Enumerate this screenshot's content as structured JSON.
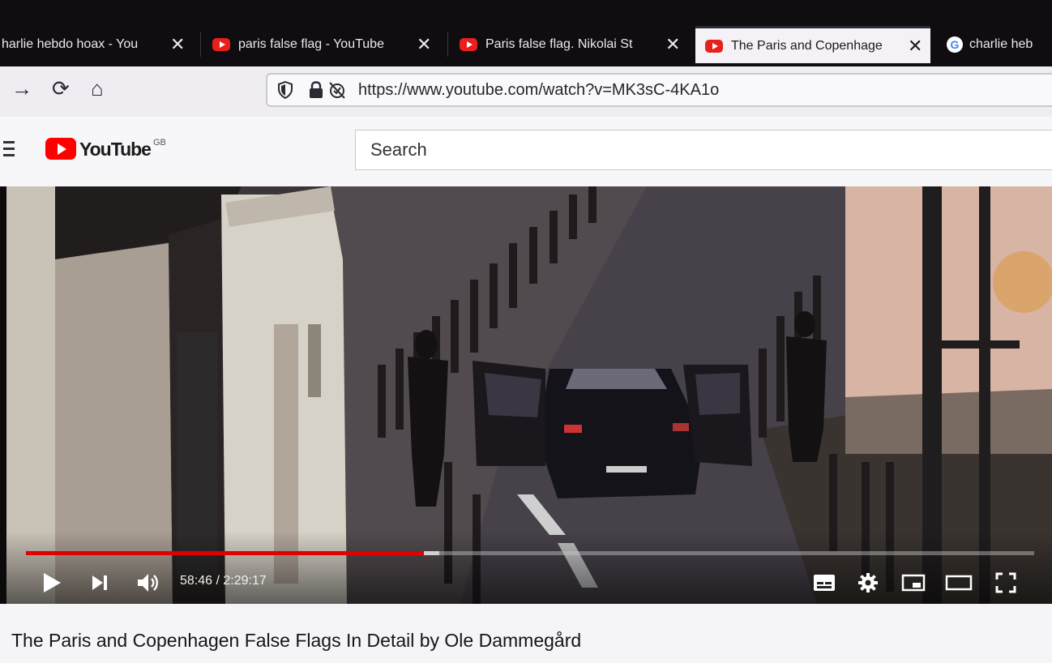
{
  "browser": {
    "tabs": [
      {
        "title": "harlie hebdo hoax - You",
        "icon": "none",
        "active": false
      },
      {
        "title": "paris false flag - YouTube",
        "icon": "youtube-icon",
        "active": false
      },
      {
        "title": "Paris false flag. Nikolai St",
        "icon": "youtube-icon",
        "active": false
      },
      {
        "title": "The Paris and Copenhage",
        "icon": "youtube-icon",
        "active": true
      },
      {
        "title": "charlie heb",
        "icon": "google-icon",
        "active": false
      }
    ],
    "close_glyph": "✕",
    "url": "https://www.youtube.com/watch?v=MK3sC-4KA1o"
  },
  "youtube": {
    "logo_text": "YouTube",
    "region": "GB",
    "search_placeholder": "Search"
  },
  "player": {
    "time_display": "58:46 / 2:29:17",
    "progress_fraction": 0.395,
    "buffered_fraction": 0.41,
    "progress_color": "#e00000"
  },
  "video": {
    "title": "The Paris and Copenhagen False Flags In Detail by Ole Dammegård"
  }
}
